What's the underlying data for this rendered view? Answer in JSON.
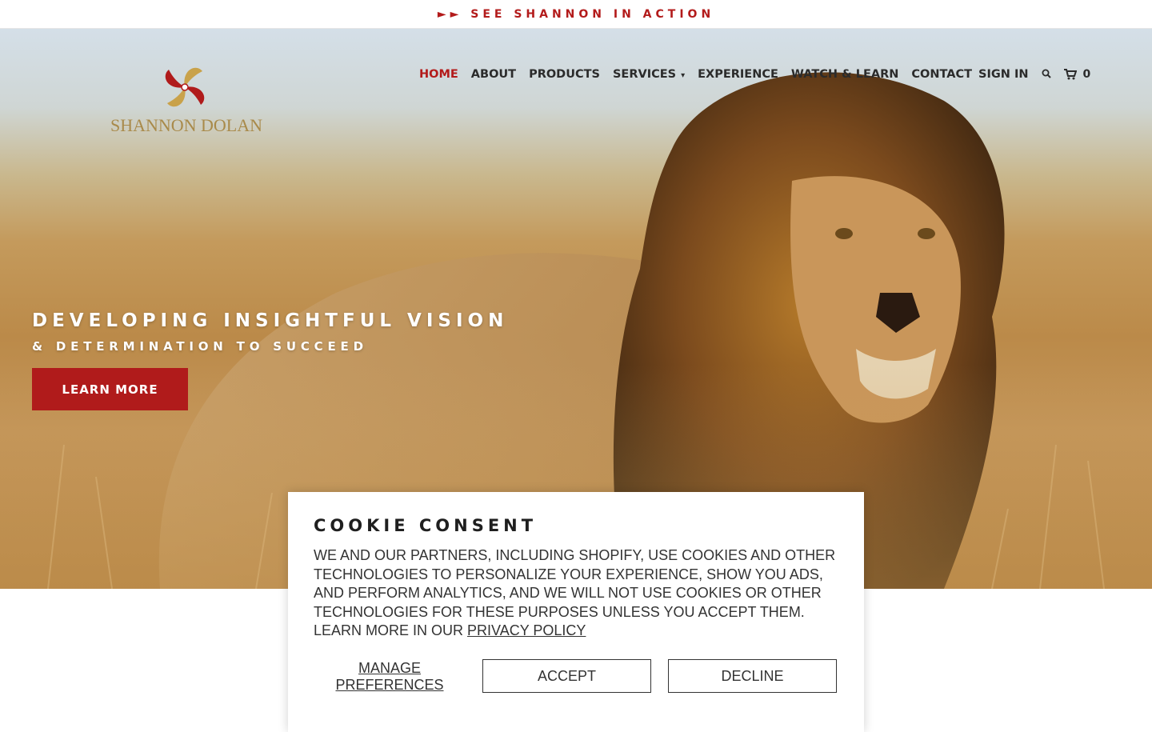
{
  "announcement": {
    "text": "►► SEE SHANNON IN ACTION"
  },
  "brand": {
    "name": "SHANNON DOLAN",
    "accent": "#b31b1b",
    "gold": "#a98a4a"
  },
  "nav": {
    "items": [
      {
        "label": "HOME",
        "active": true
      },
      {
        "label": "ABOUT"
      },
      {
        "label": "PRODUCTS"
      },
      {
        "label": "SERVICES",
        "has_caret": true
      },
      {
        "label": "EXPERIENCE"
      },
      {
        "label": "WATCH & LEARN"
      },
      {
        "label": "CONTACT"
      },
      {
        "label": "SIGN IN"
      }
    ],
    "search_icon": "search-icon",
    "cart_icon": "cart-icon",
    "cart_count": "0"
  },
  "hero": {
    "headline": "DEVELOPING INSIGHTFUL VISION",
    "subhead": "& DETERMINATION TO SUCCEED",
    "button": "LEARN MORE"
  },
  "cookie": {
    "title": "COOKIE CONSENT",
    "body": "We and our partners, including Shopify, use cookies and other technologies to personalize your experience, show you ads, and perform analytics, and we will not use cookies or other technologies for these purposes unless you accept them. Learn more in our ",
    "policy_link": "Privacy Policy",
    "manage": "MANAGE PREFERENCES",
    "accept": "ACCEPT",
    "decline": "DECLINE"
  }
}
